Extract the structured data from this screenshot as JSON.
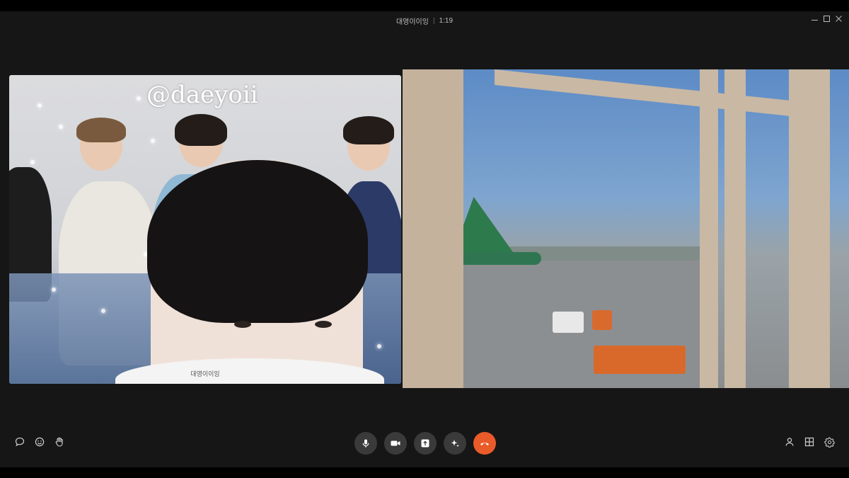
{
  "window": {
    "title": "대영이이잉",
    "duration": "1:19"
  },
  "participants": [
    {
      "name": "대영이이잉",
      "overlay_text": "@daeyoii"
    },
    {
      "name": ""
    }
  ],
  "toolbar": {
    "left_icons": [
      "chat-icon",
      "emoji-icon",
      "raise-hand-icon"
    ],
    "center_buttons": [
      "microphone-icon",
      "video-camera-icon",
      "screen-share-icon",
      "effects-icon",
      "hang-up-icon"
    ],
    "right_icons": [
      "person-icon",
      "layout-grid-icon",
      "settings-gear-icon"
    ]
  },
  "colors": {
    "hang_up": "#ea5b2a",
    "control_bg": "#3a3a3a",
    "window_bg": "#161616"
  }
}
